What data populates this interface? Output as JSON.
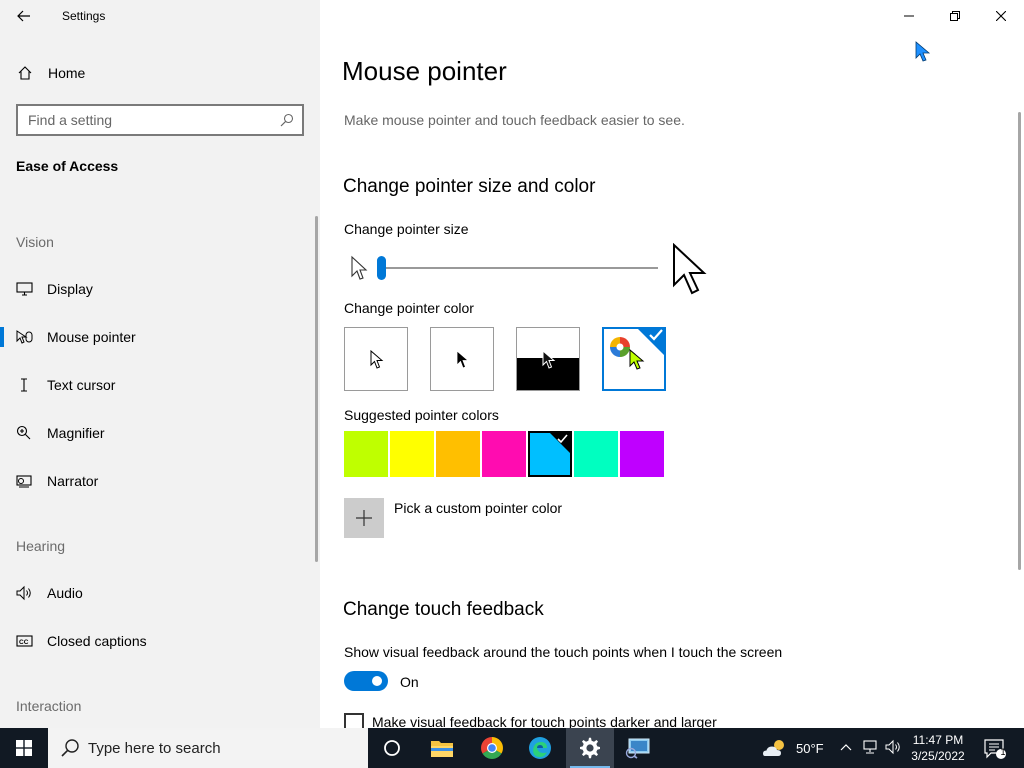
{
  "app_title": "Settings",
  "sidebar": {
    "home_label": "Home",
    "search_placeholder": "Find a setting",
    "section_title": "Ease of Access",
    "groups": {
      "vision": "Vision",
      "hearing": "Hearing",
      "interaction": "Interaction"
    },
    "items": [
      {
        "label": "Display",
        "icon": "monitor-icon"
      },
      {
        "label": "Mouse pointer",
        "icon": "mouse-pointer-icon",
        "active": true
      },
      {
        "label": "Text cursor",
        "icon": "text-cursor-icon"
      },
      {
        "label": "Magnifier",
        "icon": "magnifier-icon"
      },
      {
        "label": "Narrator",
        "icon": "narrator-icon"
      },
      {
        "label": "Audio",
        "icon": "speaker-icon"
      },
      {
        "label": "Closed captions",
        "icon": "closed-captions-icon"
      }
    ]
  },
  "main": {
    "title": "Mouse pointer",
    "description": "Make mouse pointer and touch feedback easier to see.",
    "size_color_heading": "Change pointer size and color",
    "pointer_size_label": "Change pointer size",
    "pointer_size_value": 1,
    "pointer_color_label": "Change pointer color",
    "pointer_color_options": [
      "white",
      "black",
      "inverted",
      "custom"
    ],
    "pointer_color_selected": "custom",
    "suggested_label": "Suggested pointer colors",
    "suggested_colors": [
      "#bfff00",
      "#ffff00",
      "#ffbf00",
      "#ff0cb0",
      "#00bfff",
      "#00ffc0",
      "#bf00ff"
    ],
    "suggested_selected": "#00bfff",
    "custom_color_label": "Pick a custom pointer color",
    "touch_heading": "Change touch feedback",
    "touch_feedback_label": "Show visual feedback around the touch points when I touch the screen",
    "toggle_state": "On",
    "darker_label": "Make visual feedback for touch points darker and larger"
  },
  "taskbar": {
    "search_placeholder": "Type here to search",
    "temperature": "50°F",
    "time": "11:47 PM",
    "date": "3/25/2022",
    "notification_count": "1"
  },
  "colors": {
    "accent": "#0078d7",
    "sidebar_bg": "#f2f2f2",
    "taskbar_bg": "#111923"
  }
}
